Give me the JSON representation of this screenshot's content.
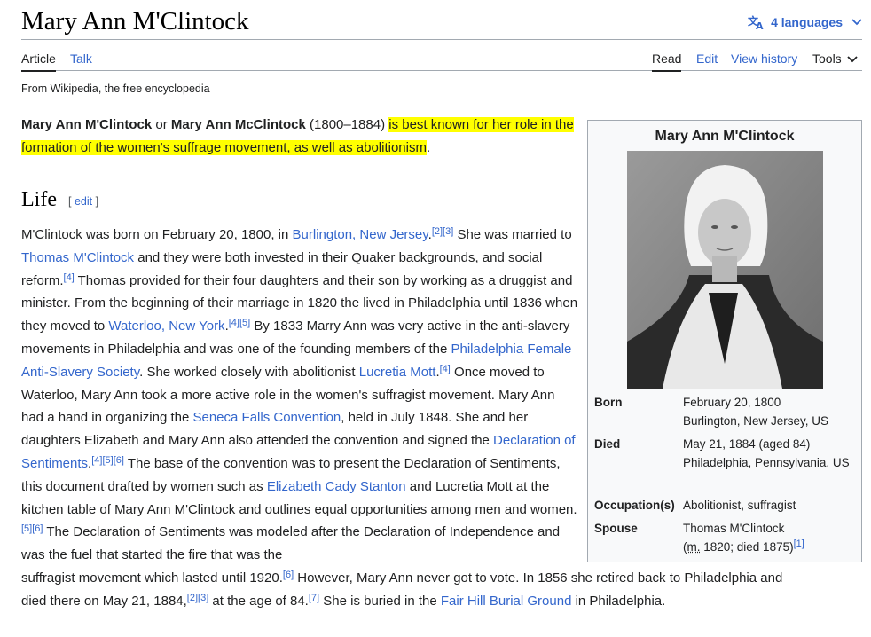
{
  "page": {
    "title": "Mary Ann M'Clintock",
    "languages": "4 languages",
    "tagline": "From Wikipedia, the free encyclopedia"
  },
  "tabs": {
    "article": "Article",
    "talk": "Talk",
    "read": "Read",
    "edit": "Edit",
    "history": "View history",
    "tools": "Tools"
  },
  "lead": {
    "name1": "Mary Ann M'Clintock",
    "or": " or ",
    "name2": "Mary Ann McClintock",
    "dates": " (1800–1884) ",
    "highlight": "is best known for her role in the formation of the women's suffrage movement, as well as abolitionism",
    "end": "."
  },
  "section": {
    "heading": "Life",
    "edit_open": "[ ",
    "edit": "edit",
    "edit_close": " ]"
  },
  "body": {
    "t1": "M'Clintock was born on February 20, 1800, in ",
    "l1": "Burlington, New Jersey",
    "r1": "[2]",
    "r2": "[3]",
    "t2": " She was married to ",
    "l2": "Thomas M'Clintock",
    "t3": " and they were both invested in their Quaker backgrounds, and social reform.",
    "r3": "[4]",
    "t4": " Thomas provided for their four daughters and their son by working as a druggist and minister. From the beginning of their marriage in 1820 the lived in Philadelphia until 1836 when they moved to ",
    "l3": "Waterloo, New York",
    "t4b": ".",
    "r4": "[4]",
    "r5": "[5]",
    "t5": " By 1833 Marry Ann was very active in the anti-slavery movements in Philadelphia and was one of the founding members of the ",
    "l4": "Philadelphia Female Anti-Slavery Society",
    "t6": ". She worked closely with abolitionist ",
    "l5": "Lucretia Mott",
    "t6b": ".",
    "r6": "[4]",
    "t7": " Once moved to Waterloo, Mary Ann took a more active role in the women's suffragist movement. Mary Ann had a hand in organizing the ",
    "l6": "Seneca Falls Convention",
    "t8": ", held in July 1848. She and her daughters Elizabeth and Mary Ann also attended the convention and signed the ",
    "l7": "Declaration of Sentiments",
    "t8b": ".",
    "r7": "[4]",
    "r8": "[5]",
    "r9": "[6]",
    "t9": " The base of the convention was to present the Declaration of Sentiments, this document drafted by women such as ",
    "l8": "Elizabeth Cady Stanton",
    "t10": " and Lucretia Mott at the kitchen table of Mary Ann M'Clintock and outlines equal opportunities among men and women.",
    "r10": "[5]",
    "r11": "[6]",
    "t11": " The Declaration of Sentiments was modeled after the Declaration of Independence and was the fuel that started the fire that was the",
    "t12": "suffragist movement which lasted until 1920.",
    "r12": "[6]",
    "t13": " However, Mary Ann never got to vote. In 1856 she retired back to Philadelphia and",
    "t14": "died there on May 21, 1884,",
    "r13": "[2]",
    "r14": "[3]",
    "t15": " at the age of 84.",
    "r15": "[7]",
    "t16": " She is buried in the ",
    "l9": "Fair Hill Burial Ground",
    "t17": " in Philadelphia."
  },
  "infobox": {
    "title": "Mary Ann M'Clintock",
    "born_label": "Born",
    "born_date": "February 20, 1800",
    "born_place": "Burlington, New Jersey, US",
    "died_label": "Died",
    "died_date": "May 21, 1884 (aged 84)",
    "died_place": "Philadelphia, Pennsylvania, US",
    "occupation_label": "Occupation(s)",
    "occupation": "Abolitionist, suffragist",
    "spouse_label": "Spouse",
    "spouse": "Thomas M'Clintock",
    "spouse_paren_open": "(",
    "spouse_m": "m.",
    "spouse_detail": " 1820; died 1875)",
    "spouse_ref": "[1]"
  },
  "colors": {
    "link": "#3366cc",
    "highlight": "#ffff00",
    "border": "#a2a9b1",
    "infobox_bg": "#f8f9fa"
  },
  "icons": {
    "language": "translate-icon",
    "dropdown": "chevron-down-icon"
  }
}
